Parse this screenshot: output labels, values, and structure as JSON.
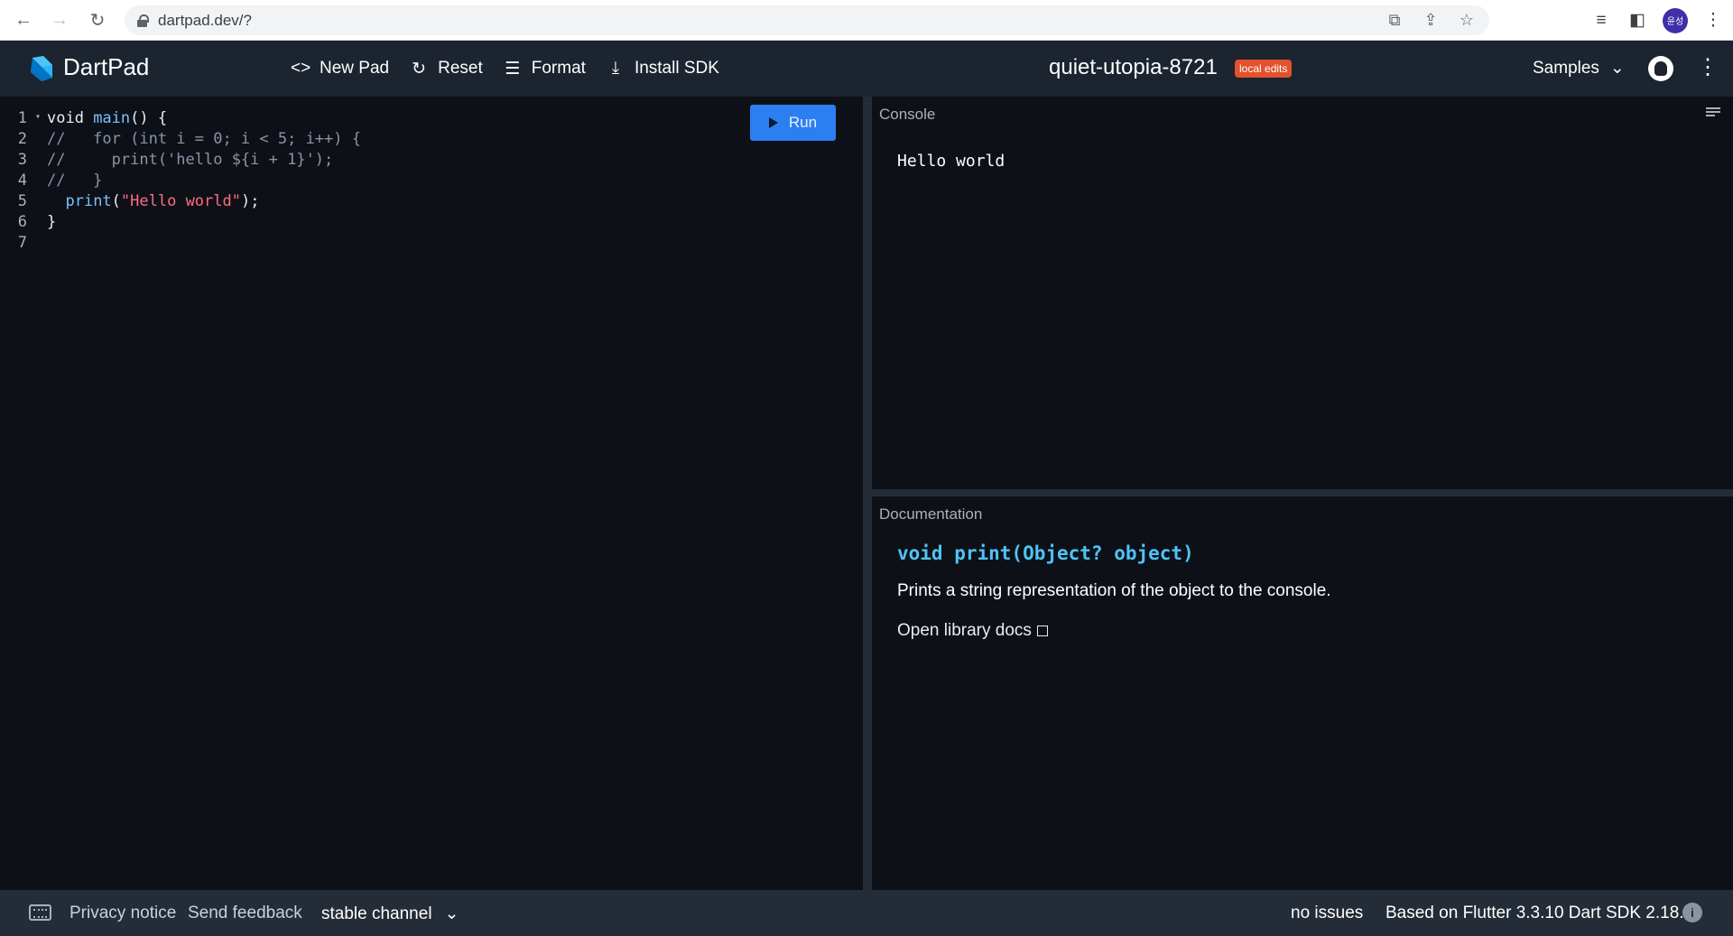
{
  "browser": {
    "url": "dartpad.dev/?",
    "profile_initials": "윤성"
  },
  "header": {
    "app_title": "DartPad",
    "new_pad": "New Pad",
    "reset": "Reset",
    "format": "Format",
    "install_sdk": "Install SDK",
    "pad_name": "quiet-utopia-8721",
    "badge": "local edits",
    "samples": "Samples"
  },
  "editor": {
    "run_label": "Run",
    "lines": [
      {
        "n": "1",
        "fold": "▾",
        "parts": [
          {
            "c": "kw",
            "t": "void "
          },
          {
            "c": "fn",
            "t": "main"
          },
          {
            "c": "kw",
            "t": "() {"
          }
        ]
      },
      {
        "n": "2",
        "fold": "",
        "parts": [
          {
            "c": "cmt",
            "t": "//   for (int i = 0; i < 5; i++) {"
          }
        ]
      },
      {
        "n": "3",
        "fold": "",
        "parts": [
          {
            "c": "cmt",
            "t": "//     print('hello ${i + 1}');"
          }
        ]
      },
      {
        "n": "4",
        "fold": "",
        "parts": [
          {
            "c": "cmt",
            "t": "//   }"
          }
        ]
      },
      {
        "n": "5",
        "fold": "",
        "parts": [
          {
            "c": "kw",
            "t": "  "
          },
          {
            "c": "fn",
            "t": "print"
          },
          {
            "c": "kw",
            "t": "("
          },
          {
            "c": "str",
            "t": "\"Hello world\""
          },
          {
            "c": "kw",
            "t": ");"
          }
        ]
      },
      {
        "n": "6",
        "fold": "",
        "parts": [
          {
            "c": "kw",
            "t": "}"
          }
        ]
      },
      {
        "n": "7",
        "fold": "",
        "parts": []
      }
    ]
  },
  "console": {
    "label": "Console",
    "output": "Hello world"
  },
  "docs": {
    "label": "Documentation",
    "signature": "void print(Object? object)",
    "description": "Prints a string representation of the object to the console.",
    "link": "Open library docs"
  },
  "footer": {
    "privacy": "Privacy notice",
    "feedback": "Send feedback",
    "channel": "stable channel",
    "issues": "no issues",
    "version": "Based on Flutter 3.3.10 Dart SDK 2.18.6"
  },
  "colors": {
    "header_bg": "#1c2430",
    "editor_bg": "#0d1117",
    "run_button": "#2d7ef0",
    "badge": "#e2522d",
    "doc_signature": "#4fc3f7"
  }
}
